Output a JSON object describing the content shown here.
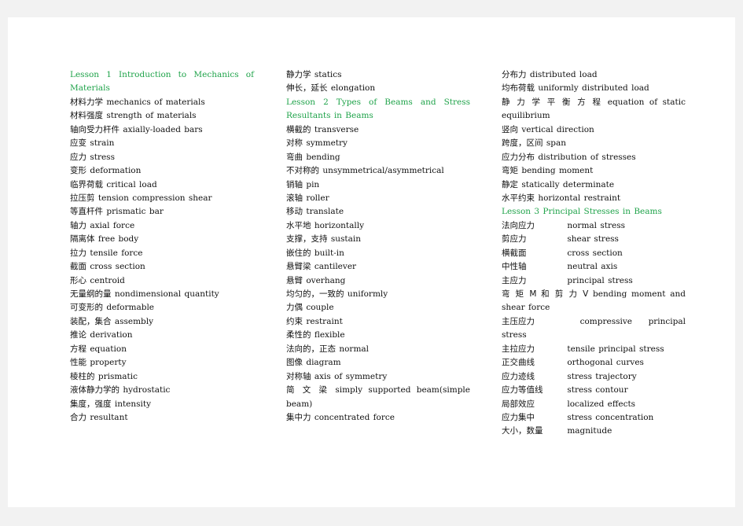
{
  "colors": {
    "heading": "#1fa34a",
    "text": "#111111"
  },
  "columns": [
    [
      {
        "type": "heading",
        "text": "Lesson 1 Introduction to Mechanics of Materials"
      },
      {
        "zh": "材料力学",
        "en": "mechanics of materials"
      },
      {
        "zh": "材料强度",
        "en": "strength of materials"
      },
      {
        "zh": "轴向受力杆件",
        "en": "axially-loaded bars"
      },
      {
        "zh": "应变",
        "en": "strain"
      },
      {
        "zh": "应力",
        "en": "stress"
      },
      {
        "zh": "变形",
        "en": "deformation"
      },
      {
        "zh": "临界荷载",
        "en": "critical load"
      },
      {
        "zh": "拉压剪",
        "en": "tension compression shear"
      },
      {
        "zh": "等直杆件",
        "en": "prismatic bar"
      },
      {
        "zh": "轴力",
        "en": "axial force"
      },
      {
        "zh": "隔离体",
        "en": "free body"
      },
      {
        "zh": "拉力",
        "en": "tensile force"
      },
      {
        "zh": "截面",
        "en": "cross section"
      },
      {
        "zh": "形心",
        "en": "centroid"
      },
      {
        "zh": "无量纲的量",
        "en": "nondimensional quantity"
      },
      {
        "zh": "可变形的",
        "en": "deformable"
      },
      {
        "zh": "装配，集合",
        "en": "assembly"
      },
      {
        "zh": "推论",
        "en": "derivation"
      },
      {
        "zh": "方程",
        "en": "equation"
      },
      {
        "zh": "性能",
        "en": "property"
      },
      {
        "zh": "棱柱的",
        "en": "prismatic"
      },
      {
        "zh": "液体静力学的",
        "en": "hydrostatic"
      },
      {
        "zh": "集度，强度",
        "en": "intensity"
      },
      {
        "zh": "合力",
        "en": "resultant"
      }
    ],
    [
      {
        "zh": "静力学",
        "en": "statics"
      },
      {
        "zh": "伸长，延长",
        "en": "elongation"
      },
      {
        "type": "heading",
        "text": "Lesson 2 Types of Beams and Stress Resultants in Beams"
      },
      {
        "zh": "横截的",
        "en": "transverse"
      },
      {
        "zh": "对称",
        "en": "symmetry"
      },
      {
        "zh": "弯曲",
        "en": "bending"
      },
      {
        "zh": "不对称的",
        "en": "unsymmetrical/asymmetrical"
      },
      {
        "zh": "销轴",
        "en": "pin"
      },
      {
        "zh": "滚轴",
        "en": "roller"
      },
      {
        "zh": "移动",
        "en": "translate"
      },
      {
        "zh": "水平地",
        "en": "horizontally"
      },
      {
        "zh": "支撑，支持",
        "en": "sustain"
      },
      {
        "zh": "嵌住的",
        "en": "built-in"
      },
      {
        "zh": "悬臂梁",
        "en": "cantilever"
      },
      {
        "zh": "悬臂",
        "en": "overhang"
      },
      {
        "zh": "均匀的，一致的",
        "en": "uniformly"
      },
      {
        "zh": "力偶",
        "en": "couple"
      },
      {
        "zh": "约束",
        "en": "restraint"
      },
      {
        "zh": "柔性的",
        "en": "flexible"
      },
      {
        "zh": "法向的，正态",
        "en": "normal"
      },
      {
        "zh": "图像",
        "en": "diagram"
      },
      {
        "zh": "对称轴",
        "en": "axis of symmetry"
      },
      {
        "zh": "简 文 梁",
        "en": "simply supported beam(simple beam)"
      },
      {
        "zh": "集中力",
        "en": "concentrated force"
      }
    ],
    [
      {
        "zh": "分布力",
        "en": "distributed load"
      },
      {
        "zh": "均布荷载",
        "en": "uniformly distributed load"
      },
      {
        "zh": "静 力 学 平 衡 方 程",
        "en": "equation of static equilibrium"
      },
      {
        "zh": "竖向",
        "en": "vertical direction"
      },
      {
        "zh": "跨度，区间",
        "en": "span"
      },
      {
        "zh": "应力分布",
        "en": "distribution of stresses"
      },
      {
        "zh": "弯矩",
        "en": "bending moment"
      },
      {
        "zh": "静定",
        "en": "statically determinate"
      },
      {
        "zh": "水平约束",
        "en": "horizontal restraint"
      },
      {
        "type": "heading",
        "text": "Lesson 3 Principal Stresses in Beams"
      },
      {
        "zh": "法向应力",
        "en": "normal stress",
        "tab": true
      },
      {
        "zh": "剪应力",
        "en": "shear stress",
        "tab": true
      },
      {
        "zh": "横截面",
        "en": "cross section",
        "tab": true
      },
      {
        "zh": "中性轴",
        "en": "neutral axis",
        "tab": true
      },
      {
        "zh": "主应力",
        "en": "principal stress",
        "tab": true
      },
      {
        "zh": "弯 矩 M 和 剪 力 V",
        "en": "bending moment and shear force"
      },
      {
        "zh": "主压应力",
        "en": "compressive principal stress",
        "tab": true
      },
      {
        "zh": "主拉应力",
        "en": "tensile principal stress",
        "tab": true
      },
      {
        "zh": "正交曲线",
        "en": "orthogonal curves",
        "tab": true
      },
      {
        "zh": "应力迹线",
        "en": "stress trajectory",
        "tab": true
      },
      {
        "zh": "应力等值线",
        "en": "stress contour",
        "tab": true
      },
      {
        "zh": "局部效应",
        "en": "localized effects",
        "tab": true
      },
      {
        "zh": "应力集中",
        "en": "stress concentration",
        "tab": true
      },
      {
        "zh": "大小，数量",
        "en": "magnitude",
        "tab": true
      }
    ]
  ]
}
